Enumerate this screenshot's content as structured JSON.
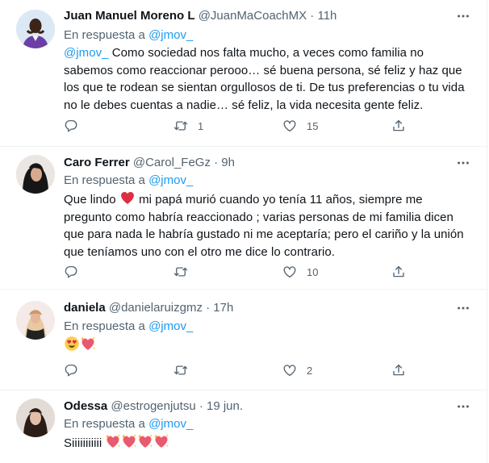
{
  "replies": [
    {
      "author_name": "Juan Manuel Moreno L",
      "author_meta": "@JuanMaCoachMX · 11h",
      "reply_prefix": "En respuesta a",
      "reply_handle": "@jmov_",
      "mention": "@jmov_",
      "text": " Como sociedad nos falta mucho, a veces como familia no sabemos como reaccionar perooo… sé buena persona, sé feliz y haz que los que te rodean se sientan orgullosos de ti. De tus preferencias o tu vida no le debes cuentas a nadie… sé feliz, la vida necesita gente feliz.",
      "reply_count": "",
      "retweet_count": "1",
      "like_count": "15"
    },
    {
      "author_name": "Caro Ferrer",
      "author_meta": "@Carol_FeGz · 9h",
      "reply_prefix": "En respuesta a",
      "reply_handle": "@jmov_",
      "text_before": "Que lindo ",
      "emoji_before": "red-heart",
      "text_after": " mi papá murió cuando yo tenía 11 años, siempre me pregunto como habría reaccionado ;  varias personas de mi familia dicen que para nada le habría gustado ni me aceptaría; pero el cariño y la unión que teníamos uno con el otro me dice lo contrario.",
      "reply_count": "",
      "retweet_count": "",
      "like_count": "10"
    },
    {
      "author_name": "daniela",
      "author_meta": "@danielaruizgmz · 17h",
      "reply_prefix": "En respuesta a",
      "reply_handle": "@jmov_",
      "emojis": [
        "smiling-face-with-heart-eyes",
        "sparkling-heart"
      ],
      "reply_count": "",
      "retweet_count": "",
      "like_count": "2"
    },
    {
      "author_name": "Odessa",
      "author_meta": "@estrogenjutsu · 19 jun.",
      "reply_prefix": "En respuesta a",
      "reply_handle": "@jmov_",
      "text": "Siiiiiiiiiii ",
      "emojis": [
        "sparkling-heart",
        "sparkling-heart",
        "sparkling-heart",
        "sparkling-heart"
      ]
    }
  ],
  "colors": {
    "link": "#1d9bf0",
    "muted": "#536471",
    "text": "#0f1419",
    "heart": "#e0245e",
    "divider": "#eff3f4"
  }
}
